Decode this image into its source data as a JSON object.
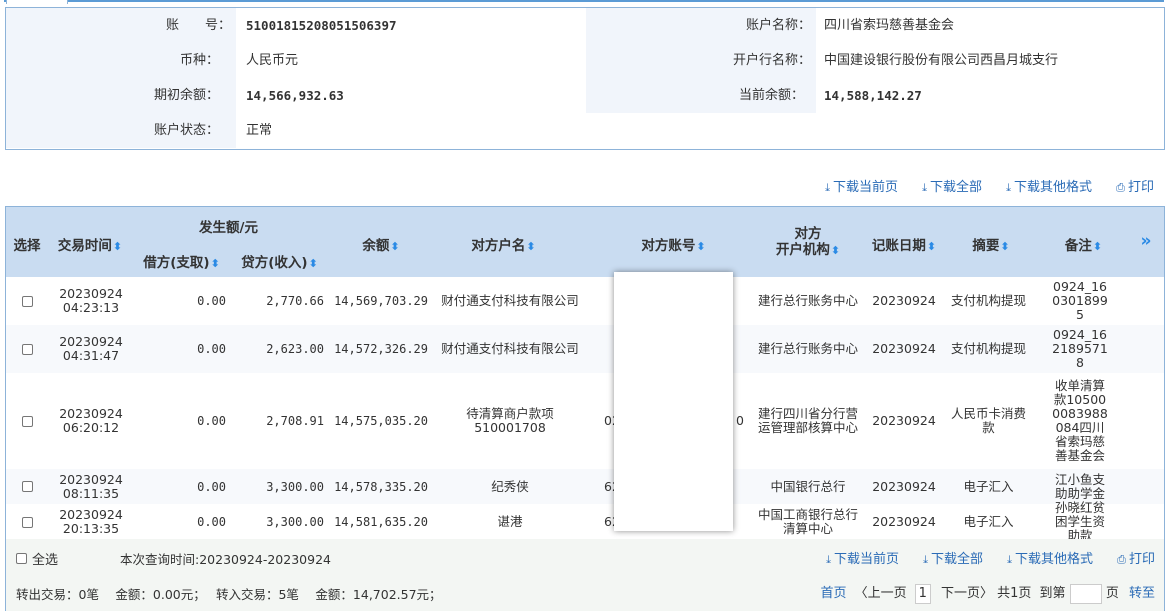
{
  "account": {
    "account_no_label": "账　　号：",
    "account_no": "51001815208051506397",
    "account_name_label": "账户名称：",
    "account_name": "四川省索玛慈善基金会",
    "currency_label": "币种：",
    "currency": "人民币元",
    "bank_label": "开户行名称：",
    "bank": "中国建设银行股份有限公司西昌月城支行",
    "opening_balance_label": "期初余额：",
    "opening_balance": "14,566,932.63",
    "current_balance_label": "当前余额：",
    "current_balance": "14,588,142.27",
    "status_label": "账户状态：",
    "status": "正常"
  },
  "actions": {
    "download_page": "下载当前页",
    "download_all": "下载全部",
    "download_other": "下载其他格式",
    "print": "打印"
  },
  "table": {
    "headers": {
      "select": "选择",
      "time": "交易时间",
      "amount_group": "发生额/元",
      "debit": "借方(支取)",
      "credit": "贷方(收入)",
      "balance": "余额",
      "counterparty_name": "对方户名",
      "counterparty_account": "对方账号",
      "counterparty_bank_1": "对方",
      "counterparty_bank_2": "开户机构",
      "post_date": "记账日期",
      "summary": "摘要",
      "remark": "备注",
      "more": "»"
    },
    "sort_icon": "⬍",
    "rows": [
      {
        "date": "20230924",
        "time": "04:23:13",
        "debit": "0.00",
        "credit": "2,770.66",
        "balance": "14,569,703.29",
        "name": "财付通支付科技有限公司",
        "account": "",
        "bank": "建行总行账务中心",
        "post_date": "20230924",
        "summary": "支付机构提现",
        "remark": "0924_1603018995"
      },
      {
        "date": "20230924",
        "time": "04:31:47",
        "debit": "0.00",
        "credit": "2,623.00",
        "balance": "14,572,326.29",
        "name": "财付通支付科技有限公司",
        "account": "",
        "bank": "建行总行账务中心",
        "post_date": "20230924",
        "summary": "支付机构提现",
        "remark": "0924_1621895718"
      },
      {
        "date": "20230924",
        "time": "06:20:12",
        "debit": "0.00",
        "credit": "2,708.91",
        "balance": "14,575,035.20",
        "name": "待清算商户款项510001708",
        "account": "02",
        "account_tail": "0",
        "bank": "建行四川省分行营运管理部核算中心",
        "post_date": "20230924",
        "summary": "人民币卡消费款",
        "remark": "收单清算款105000083988084四川省索玛慈善基金会"
      },
      {
        "date": "20230924",
        "time": "08:11:35",
        "debit": "0.00",
        "credit": "3,300.00",
        "balance": "14,578,335.20",
        "name": "纪秀侠",
        "account": "621",
        "bank": "中国银行总行",
        "post_date": "20230924",
        "summary": "电子汇入",
        "remark": "江小鱼支助助学金"
      },
      {
        "date": "20230924",
        "time": "20:13:35",
        "debit": "0.00",
        "credit": "3,300.00",
        "balance": "14,581,635.20",
        "name": "谌港",
        "account": "621",
        "bank": "中国工商银行总行清算中心",
        "post_date": "20230924",
        "summary": "电子汇入",
        "remark": "孙晓红贫困学生资助款"
      }
    ]
  },
  "footer": {
    "select_all": "全选",
    "query_time": "本次查询时间:20230924-20230924",
    "stats": "转出交易：0笔　 金额：0.00元；　 转入交易：5笔　 金额：14,702.57元；",
    "first": "首页",
    "prev": "〈上一页",
    "page": "1",
    "next": "下一页〉",
    "total": "共1页",
    "goto": "到第",
    "page_unit": "页",
    "go": "转至"
  }
}
